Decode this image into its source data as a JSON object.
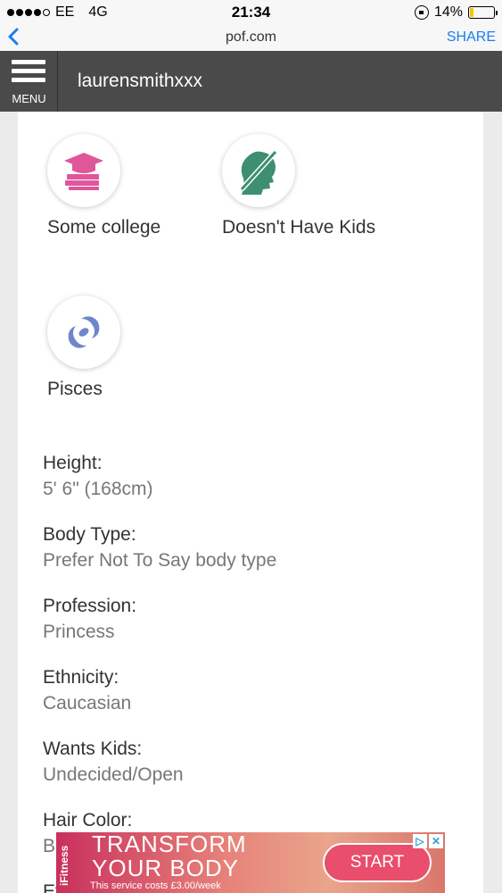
{
  "status_bar": {
    "carrier": "EE",
    "network": "4G",
    "time": "21:34",
    "battery_percent": "14%",
    "battery_level": 0.14
  },
  "browser": {
    "url": "pof.com",
    "share_label": "SHARE"
  },
  "header": {
    "menu_label": "MENU",
    "username": "laurensmithxxx"
  },
  "icons": [
    {
      "label": "Some college",
      "icon": "graduation-books-icon",
      "color": "#e0569b"
    },
    {
      "label": "Doesn't Have Kids",
      "icon": "no-kids-icon",
      "color": "#3d8f6f"
    },
    {
      "label": "Pisces",
      "icon": "pisces-icon",
      "color": "#6f86cc"
    }
  ],
  "details": [
    {
      "label": "Height:",
      "value": "5' 6\" (168cm)"
    },
    {
      "label": "Body Type:",
      "value": "Prefer Not To Say body type"
    },
    {
      "label": "Profession:",
      "value": "Princess"
    },
    {
      "label": "Ethnicity:",
      "value": "Caucasian"
    },
    {
      "label": "Wants Kids:",
      "value": "Undecided/Open"
    },
    {
      "label": "Hair Color:",
      "value": "B"
    },
    {
      "label": "Ey",
      "value": ""
    }
  ],
  "ad": {
    "brand": "iFitness",
    "headline_1": "TRANSFORM",
    "headline_2": "YOUR BODY",
    "fine_print": "This service costs £3.00/week",
    "cta": "START",
    "adchoices": "▷",
    "close": "✕"
  }
}
